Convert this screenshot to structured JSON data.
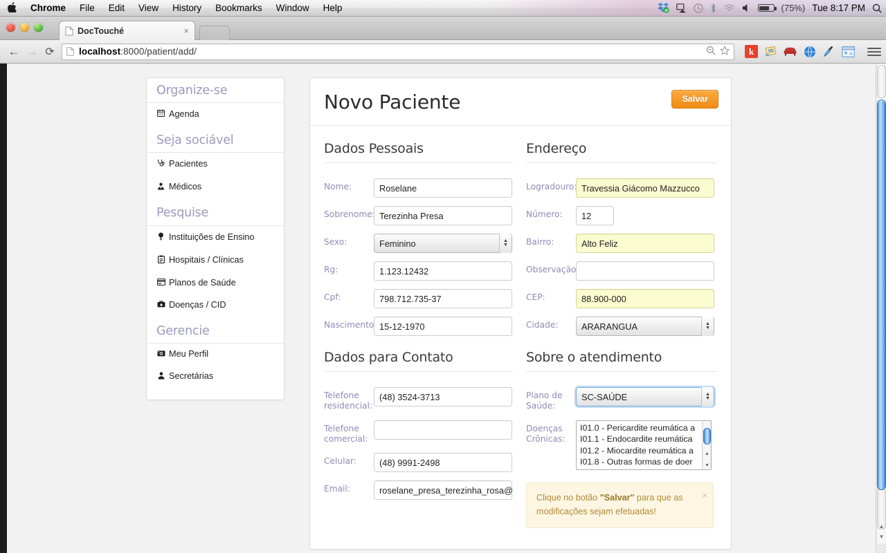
{
  "os_menu": {
    "apple_icon": "apple-icon",
    "items": [
      "Chrome",
      "File",
      "Edit",
      "View",
      "History",
      "Bookmarks",
      "Window",
      "Help"
    ],
    "status": {
      "dropbox_icon": "dropbox-icon",
      "airplay_icon": "airplay-icon",
      "timemachine_icon": "time-machine-icon",
      "bluetooth_icon": "bluetooth-icon",
      "wifi_icon": "wifi-icon",
      "volume_icon": "volume-icon",
      "battery_icon": "battery-icon",
      "battery_percent": "(75%)",
      "clock": "Tue 8:17 PM",
      "spotlight_icon": "search-icon"
    }
  },
  "browser": {
    "tab_title": "DocTouché",
    "tab_close": "×",
    "back_icon": "back-arrow-icon",
    "forward_icon": "forward-arrow-icon",
    "reload_icon": "reload-icon",
    "url_host": "localhost",
    "url_path": ":8000/patient/add/",
    "zoom_icon": "zoom-out-icon",
    "bookmark_icon": "star-icon",
    "extensions": [
      "k",
      "notes-icon",
      "couch-icon",
      "globe-icon",
      "eyedropper-icon",
      "window-icon"
    ],
    "menu_icon": "hamburger-menu-icon"
  },
  "sidebar": {
    "groups": [
      {
        "heading": "Organize-se",
        "items": [
          {
            "icon": "calendar-icon",
            "glyph": "Ὄ5",
            "label": "Agenda"
          }
        ]
      },
      {
        "heading": "Seja sociável",
        "items": [
          {
            "icon": "stethoscope-icon",
            "label": "Pacientes"
          },
          {
            "icon": "doctor-icon",
            "label": "Médicos"
          }
        ]
      },
      {
        "heading": "Pesquise",
        "items": [
          {
            "icon": "lightbulb-icon",
            "label": "Instituições de Ensino"
          },
          {
            "icon": "clipboard-icon",
            "label": "Hospitais / Clínicas"
          },
          {
            "icon": "card-icon",
            "label": "Planos de Saúde"
          },
          {
            "icon": "medkit-icon",
            "label": "Doenças / CID"
          }
        ]
      },
      {
        "heading": "Gerencie",
        "items": [
          {
            "icon": "camera-icon",
            "label": "Meu Perfil"
          },
          {
            "icon": "user-icon",
            "label": "Secretárias"
          }
        ]
      }
    ]
  },
  "main": {
    "title": "Novo Paciente",
    "save_label": "Salvar",
    "sections": {
      "dados_pessoais": {
        "title": "Dados Pessoais",
        "fields": [
          {
            "label": "Nome:",
            "value": "Roselane",
            "type": "text",
            "highlight": false
          },
          {
            "label": "Sobrenome:",
            "value": "Terezinha Presa",
            "type": "text",
            "highlight": false
          },
          {
            "label": "Sexo:",
            "value": "Feminino",
            "type": "select",
            "highlight": false
          },
          {
            "label": "Rg:",
            "value": "1.123.12432",
            "type": "text",
            "highlight": false
          },
          {
            "label": "Cpf:",
            "value": "798.712.735-37",
            "type": "text",
            "highlight": false
          },
          {
            "label": "Nascimento:",
            "value": "15-12-1970",
            "type": "text",
            "highlight": false
          }
        ]
      },
      "endereco": {
        "title": "Endereço",
        "fields": [
          {
            "label": "Logradouro:",
            "value": "Travessia Giácomo Mazzucco",
            "type": "text",
            "highlight": true
          },
          {
            "label": "Número:",
            "value": "12",
            "type": "text-small",
            "highlight": false
          },
          {
            "label": "Bairro:",
            "value": "Alto Feliz",
            "type": "text",
            "highlight": true
          },
          {
            "label": "Observação:",
            "value": "",
            "type": "text",
            "highlight": false
          },
          {
            "label": "CEP:",
            "value": "88.900-000",
            "type": "text",
            "highlight": true
          },
          {
            "label": "Cidade:",
            "value": "ARARANGUA",
            "type": "select",
            "highlight": false
          }
        ]
      },
      "contato": {
        "title": "Dados para Contato",
        "fields": [
          {
            "label": "Telefone residencial:",
            "value": "(48) 3524-3713",
            "type": "text",
            "highlight": false
          },
          {
            "label": "Telefone comercial:",
            "value": "",
            "type": "text",
            "highlight": false
          },
          {
            "label": "Celular:",
            "value": "(48) 9991-2498",
            "type": "text",
            "highlight": false
          },
          {
            "label": "Email:",
            "value": "roselane_presa_terezinha_rosa@",
            "type": "text",
            "highlight": false
          }
        ]
      },
      "atendimento": {
        "title": "Sobre o atendimento",
        "plano_label": "Plano de Saúde:",
        "plano_value": "SC-SAÚDE",
        "doencas_label": "Doenças Crônicas:",
        "doencas_options": [
          "I01.0 - Pericardite reumática a",
          "I01.1 - Endocardite reumática",
          "I01.2 - Miocardite reumática a",
          "I01.8 - Outras formas de doer"
        ]
      }
    },
    "alert": {
      "text_before": "Clique no botão ",
      "strong": "\"Salvar\"",
      "text_after": " para que as modificações sejam efetuadas!",
      "close": "×"
    }
  },
  "colors": {
    "accent_orange": "#f49b28",
    "label_purple": "#8c8cb8",
    "heading_purple": "#9a9ac0",
    "highlight_yellow": "#fbfbd0",
    "alert_bg": "#fdf6e2",
    "alert_text": "#b08a39",
    "scrollbar_blue": "#4a8bd8"
  }
}
